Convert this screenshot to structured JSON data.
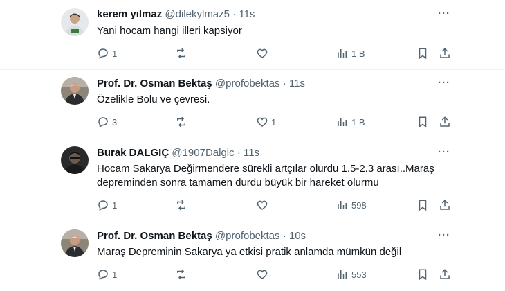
{
  "tweets": [
    {
      "name": "kerem yılmaz",
      "handle": "@dilekylmaz5",
      "dot": "·",
      "time": "11s",
      "text_lines": [
        "Yani hocam hangi illeri kapsiyor"
      ],
      "replies": "1",
      "retweets": "",
      "likes": "",
      "views": "1 B",
      "avatar": "person-photo"
    },
    {
      "name": "Prof. Dr. Osman Bektaş",
      "handle": "@profobektas",
      "dot": "·",
      "time": "11s",
      "text_lines": [
        "Özelikle Bolu ve çevresi."
      ],
      "replies": "3",
      "retweets": "",
      "likes": "1",
      "views": "1 B",
      "avatar": "person-photo"
    },
    {
      "name": "Burak DALGIÇ",
      "handle": "@1907Dalgic",
      "dot": "·",
      "time": "11s",
      "text_lines": [
        "Hocam Sakarya Değirmendere sürekli artçılar olurdu 1.5-2.3 arası..Maraş",
        "depreminden sonra tamamen durdu büyük bir hareket olurmu"
      ],
      "replies": "1",
      "retweets": "",
      "likes": "",
      "views": "598",
      "avatar": "person-photo"
    },
    {
      "name": "Prof. Dr. Osman Bektaş",
      "handle": "@profobektas",
      "dot": "·",
      "time": "10s",
      "text_lines": [
        "Maraş Depreminin Sakarya ya etkisi pratik anlamda mümkün değil"
      ],
      "replies": "1",
      "retweets": "",
      "likes": "",
      "views": "553",
      "avatar": "person-photo"
    }
  ],
  "icons": {
    "reply": "reply-icon",
    "retweet": "retweet-icon",
    "like": "heart-icon",
    "views": "views-icon",
    "bookmark": "bookmark-icon",
    "share": "share-icon",
    "more": "more-icon"
  },
  "colors": {
    "text": "#0f1419",
    "secondary": "#536471",
    "divider": "#eff3f4"
  },
  "more_glyph": "···"
}
